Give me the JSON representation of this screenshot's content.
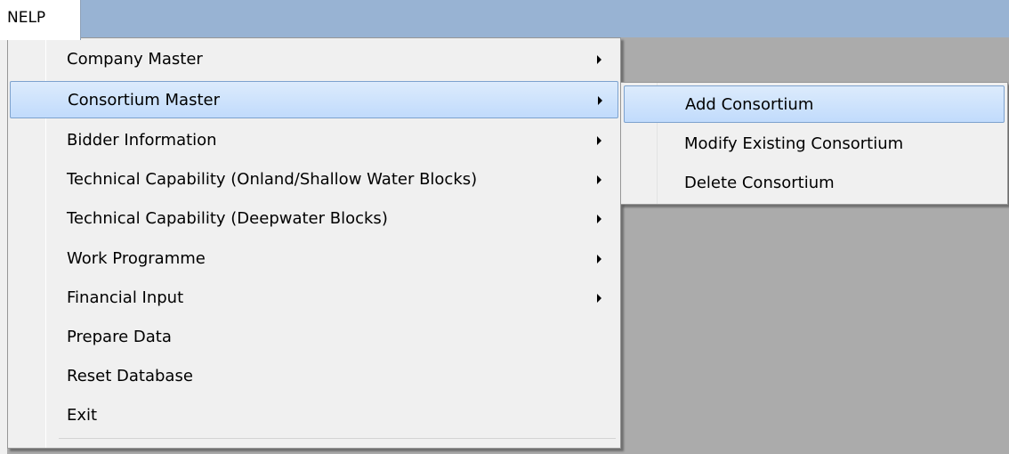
{
  "menubar": {
    "title": "NELP"
  },
  "menu": {
    "items": [
      {
        "label": "Company Master",
        "has_submenu": true
      },
      {
        "label": "Consortium Master",
        "has_submenu": true,
        "highlighted": true
      },
      {
        "label": "Bidder Information",
        "has_submenu": true
      },
      {
        "label": "Technical Capability (Onland/Shallow Water Blocks)",
        "has_submenu": true
      },
      {
        "label": "Technical Capability (Deepwater Blocks)",
        "has_submenu": true
      },
      {
        "label": "Work Programme",
        "has_submenu": true
      },
      {
        "label": "Financial Input",
        "has_submenu": true
      },
      {
        "label": "Prepare Data",
        "has_submenu": false
      },
      {
        "label": "Reset Database",
        "has_submenu": false
      },
      {
        "label": "Exit",
        "has_submenu": false
      }
    ]
  },
  "submenu": {
    "items": [
      {
        "label": "Add Consortium",
        "highlighted": true
      },
      {
        "label": "Modify Existing Consortium"
      },
      {
        "label": "Delete Consortium"
      }
    ]
  },
  "colors": {
    "menubar": "#98b3d3",
    "client_area": "#ababab",
    "menu_bg": "#f0f0f0",
    "highlight": "#c1dbfc",
    "highlight_border": "#7da2ce"
  }
}
